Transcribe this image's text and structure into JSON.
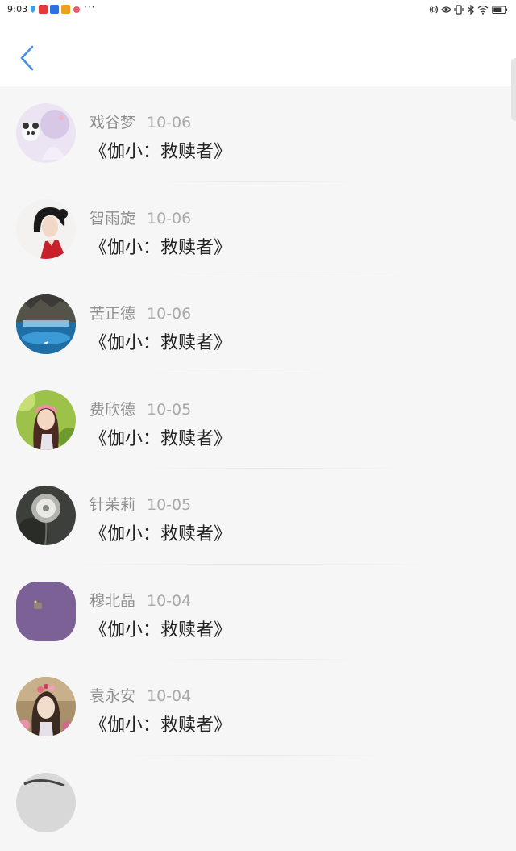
{
  "status_bar": {
    "time": "9:03",
    "more": "···",
    "icons": [
      "nfc-icon",
      "eye-icon",
      "vibrate-icon",
      "bluetooth-icon",
      "wifi-icon",
      "battery-icon"
    ]
  },
  "header": {
    "back_icon": "chevron-left-icon",
    "accent_color": "#4a90e2"
  },
  "comments": [
    {
      "name": "戏谷梦",
      "date": "10-06",
      "text": "《伽小：救赎者》"
    },
    {
      "name": "智雨旋",
      "date": "10-06",
      "text": "《伽小：救赎者》"
    },
    {
      "name": "苦正德",
      "date": "10-06",
      "text": "《伽小：救赎者》"
    },
    {
      "name": "费欣德",
      "date": "10-05",
      "text": "《伽小：救赎者》"
    },
    {
      "name": "针茉莉",
      "date": "10-05",
      "text": "《伽小：救赎者》"
    },
    {
      "name": "穆北晶",
      "date": "10-04",
      "text": "《伽小：救赎者》"
    },
    {
      "name": "袁永安",
      "date": "10-04",
      "text": "《伽小：救赎者》"
    }
  ]
}
